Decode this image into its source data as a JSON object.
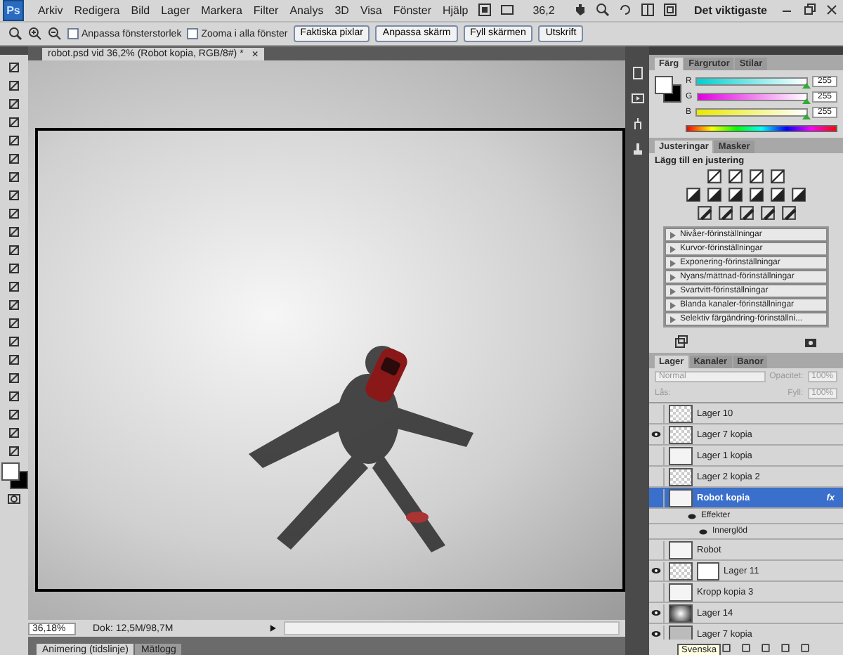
{
  "app_logo": "Ps",
  "menu": [
    "Arkiv",
    "Redigera",
    "Bild",
    "Lager",
    "Markera",
    "Filter",
    "Analys",
    "3D",
    "Visa",
    "Fönster",
    "Hjälp"
  ],
  "zoom_value": "36,2",
  "workspace": "Det viktigaste",
  "options": {
    "checkboxes": [
      {
        "label": "Anpassa fönsterstorlek",
        "checked": false
      },
      {
        "label": "Zooma i alla fönster",
        "checked": false
      }
    ],
    "buttons": [
      "Faktiska pixlar",
      "Anpassa skärm",
      "Fyll skärmen",
      "Utskrift"
    ]
  },
  "document": {
    "tab": "robot.psd vid 36,2% (Robot kopia, RGB/8#) *",
    "close": "×"
  },
  "status": {
    "zoom": "36,18%",
    "info": "Dok: 12,5M/98,7M"
  },
  "bottom_tabs": [
    {
      "label": "Animering (tidslinje)",
      "selected": true
    },
    {
      "label": "Mätlogg",
      "selected": false
    }
  ],
  "color_panel": {
    "tabs": [
      {
        "label": "Färg",
        "selected": true
      },
      {
        "label": "Färgrutor",
        "selected": false
      },
      {
        "label": "Stilar",
        "selected": false
      }
    ],
    "sliders": [
      {
        "kind": "r",
        "label": "R",
        "value": "255",
        "level": 1
      },
      {
        "kind": "g",
        "label": "G",
        "value": "255",
        "level": 1
      },
      {
        "kind": "b",
        "label": "B",
        "value": "255",
        "level": 1
      }
    ]
  },
  "adjustments_panel": {
    "tabs": [
      {
        "label": "Justeringar",
        "selected": true
      },
      {
        "label": "Masker",
        "selected": false
      }
    ],
    "heading": "Lägg till en justering",
    "presets": [
      "Nivåer-förinställningar",
      "Kurvor-förinställningar",
      "Exponering-förinställningar",
      "Nyans/mättnad-förinställningar",
      "Svartvitt-förinställningar",
      "Blanda kanaler-förinställningar",
      "Selektiv färgändring-förinställni..."
    ]
  },
  "layers_panel": {
    "tabs": [
      {
        "label": "Lager",
        "selected": true
      },
      {
        "label": "Kanaler",
        "selected": false
      },
      {
        "label": "Banor",
        "selected": false
      }
    ],
    "blend": "Normal",
    "opacity_label": "Opacitet:",
    "opacity": "100%",
    "lock_label": "Lås:",
    "fill_label": "Fyll:",
    "fill": "100%",
    "layers": [
      {
        "name": "Lager 10",
        "visible": false,
        "selected": false,
        "kind": "transparent"
      },
      {
        "name": "Lager 7 kopia",
        "visible": true,
        "selected": false,
        "kind": "transparent"
      },
      {
        "name": "Lager 1 kopia",
        "visible": false,
        "selected": false,
        "kind": "figure"
      },
      {
        "name": "Lager 2 kopia 2",
        "visible": false,
        "selected": false,
        "kind": "transparent"
      },
      {
        "name": "Robot kopia",
        "visible": false,
        "selected": true,
        "kind": "figure",
        "fx": "fx",
        "effects_label": "Effekter",
        "effects": [
          "Innerglöd"
        ]
      },
      {
        "name": "Robot",
        "visible": false,
        "selected": false,
        "kind": "figure"
      },
      {
        "name": "Lager 11",
        "visible": true,
        "selected": false,
        "kind": "transparent",
        "mask": true
      },
      {
        "name": "Kropp kopia 3",
        "visible": false,
        "selected": false,
        "kind": "figure"
      },
      {
        "name": "Lager 14",
        "visible": true,
        "selected": false,
        "kind": "gradient"
      },
      {
        "name": "Lager 7 kopia",
        "visible": true,
        "selected": false,
        "kind": "plain"
      }
    ],
    "tooltip": "Svenska"
  }
}
